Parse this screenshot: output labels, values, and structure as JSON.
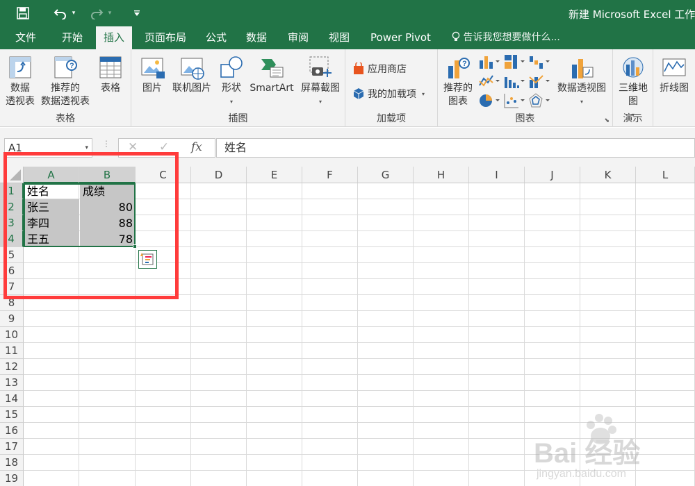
{
  "title_bar": {
    "doc_title": "新建 Microsoft Excel 工作",
    "qat": [
      {
        "name": "save-icon",
        "glyph": "💾"
      },
      {
        "name": "undo-icon",
        "glyph": "↶"
      },
      {
        "name": "redo-icon",
        "glyph": "↷"
      },
      {
        "name": "customize-qat-icon",
        "glyph": "▾"
      }
    ]
  },
  "tabs": [
    {
      "label": "文件",
      "name": "tab-file"
    },
    {
      "label": "开始",
      "name": "tab-home"
    },
    {
      "label": "插入",
      "name": "tab-insert",
      "active": true
    },
    {
      "label": "页面布局",
      "name": "tab-page-layout"
    },
    {
      "label": "公式",
      "name": "tab-formulas"
    },
    {
      "label": "数据",
      "name": "tab-data"
    },
    {
      "label": "审阅",
      "name": "tab-review"
    },
    {
      "label": "视图",
      "name": "tab-view"
    },
    {
      "label": "Power Pivot",
      "name": "tab-power-pivot"
    }
  ],
  "tell_me": "告诉我您想要做什么...",
  "ribbon": {
    "groups": {
      "tables": {
        "label": "表格",
        "pivot_table": "数据\n透视表",
        "recommended_pivot": "推荐的\n数据透视表",
        "table": "表格"
      },
      "illustrations": {
        "label": "插图",
        "pictures": "图片",
        "online_pictures": "联机图片",
        "shapes": "形状",
        "smartart": "SmartArt",
        "screenshot": "屏幕截图"
      },
      "addins": {
        "label": "加载项",
        "store": "应用商店",
        "my_addins": "我的加载项"
      },
      "charts": {
        "label": "图表",
        "recommended_charts": "推荐的\n图表",
        "pivot_chart": "数据透视图"
      },
      "tours": {
        "label": "演示",
        "map3d": "三维地\n图"
      },
      "sparklines": {
        "line": "折线图"
      }
    },
    "colors": {
      "brand": "#217346"
    }
  },
  "formula_bar": {
    "name_box": "A1",
    "cancel": "✕",
    "enter": "✓",
    "fx": "fx",
    "formula": "姓名"
  },
  "sheet": {
    "columns": [
      "A",
      "B",
      "C",
      "D",
      "E",
      "F",
      "G",
      "H",
      "I",
      "J",
      "K",
      "L"
    ],
    "rows": [
      "1",
      "2",
      "3",
      "4",
      "5",
      "6",
      "7",
      "8",
      "9",
      "10",
      "11",
      "12",
      "13",
      "14",
      "15",
      "16",
      "17",
      "18",
      "19"
    ],
    "cells": [
      {
        "ref": "A1",
        "value": "姓名"
      },
      {
        "ref": "B1",
        "value": "成绩"
      },
      {
        "ref": "A2",
        "value": "张三"
      },
      {
        "ref": "B2",
        "value": "80"
      },
      {
        "ref": "A3",
        "value": "李四"
      },
      {
        "ref": "B3",
        "value": "88"
      },
      {
        "ref": "A4",
        "value": "王五"
      },
      {
        "ref": "B4",
        "value": "78"
      }
    ],
    "selection": "A1:B4",
    "highlight_color": "#ff3b3b"
  },
  "watermark": {
    "logo": "Bai 经验",
    "url": "jingyan.baidu.com"
  }
}
